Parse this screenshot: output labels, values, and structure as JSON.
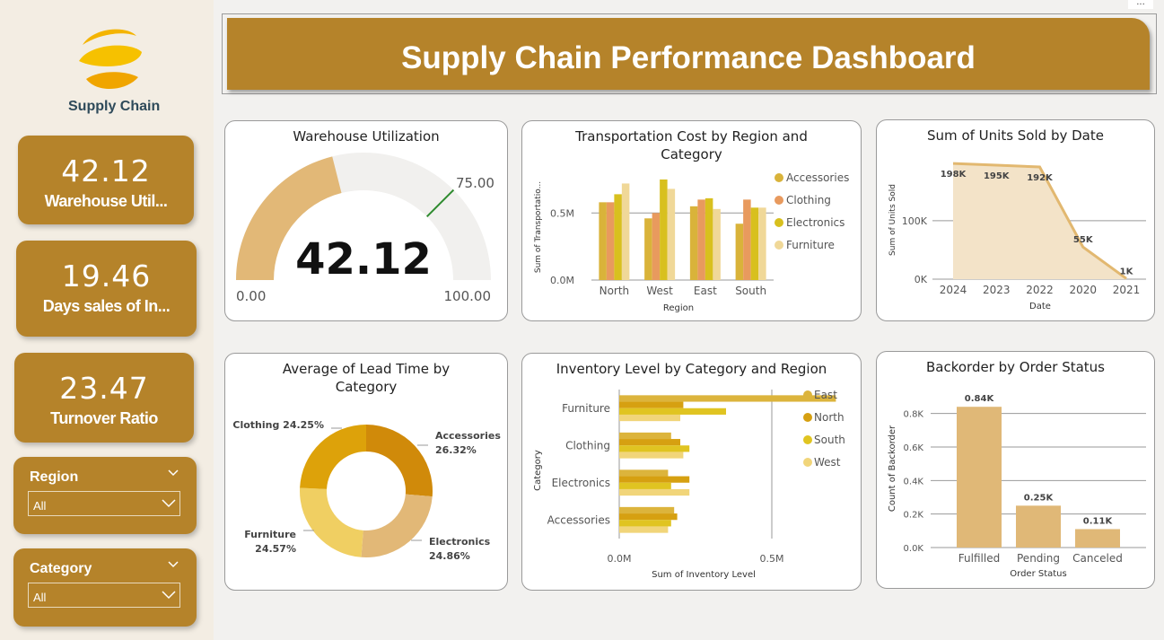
{
  "brand": {
    "name": "Supply Chain"
  },
  "header": {
    "title": "Supply Chain Performance Dashboard",
    "more_menu": "..."
  },
  "kpis": [
    {
      "value": "42.12",
      "label": "Warehouse Util..."
    },
    {
      "value": "19.46",
      "label": "Days sales of In..."
    },
    {
      "value": "23.47",
      "label": "Turnover Ratio"
    }
  ],
  "slicers": {
    "region": {
      "label": "Region",
      "value": "All"
    },
    "category": {
      "label": "Category",
      "value": "All"
    }
  },
  "colors": {
    "gold": "#b5832a",
    "accessories": "#d9b33a",
    "clothing": "#e89a5e",
    "electronics": "#d8c01e",
    "furniture": "#f0d898",
    "area": "#e2b870"
  },
  "cards": {
    "warehouse": {
      "title": "Warehouse Utilization"
    },
    "transport": {
      "title_line1": "Transportation Cost by Region and",
      "title_line2": "Category"
    },
    "units": {
      "title": "Sum of Units Sold by Date"
    },
    "leadtime": {
      "title_line1": "Average of Lead Time by",
      "title_line2": "Category"
    },
    "inventory": {
      "title": "Inventory Level by Category and Region"
    },
    "backorder": {
      "title": "Backorder by Order Status"
    }
  },
  "chart_data": [
    {
      "type": "gauge",
      "title": "Warehouse Utilization",
      "value": 42.12,
      "value_label": "42.12",
      "min": 0,
      "max": 100,
      "target": 75,
      "min_label": "0.00",
      "max_label": "100.00",
      "target_label": "75.00"
    },
    {
      "type": "bar",
      "title": "Transportation Cost by Region and Category",
      "xlabel": "Region",
      "ylabel": "Sum of Transportatio...",
      "categories": [
        "North",
        "West",
        "East",
        "South"
      ],
      "yticks": [
        "0.0M",
        "0.5M"
      ],
      "ylim": [
        0,
        0.85
      ],
      "series": [
        {
          "name": "Accessories",
          "color": "#d9b33a",
          "values": [
            0.58,
            0.46,
            0.55,
            0.42
          ]
        },
        {
          "name": "Clothing",
          "color": "#e89a5e",
          "values": [
            0.58,
            0.5,
            0.6,
            0.6
          ]
        },
        {
          "name": "Electronics",
          "color": "#d8c01e",
          "values": [
            0.64,
            0.75,
            0.61,
            0.54
          ]
        },
        {
          "name": "Furniture",
          "color": "#f0d898",
          "values": [
            0.72,
            0.68,
            0.53,
            0.54
          ]
        }
      ],
      "legend": "right"
    },
    {
      "type": "area",
      "title": "Sum of Units Sold by Date",
      "xlabel": "Date",
      "ylabel": "Sum of Units Sold",
      "x": [
        "2024",
        "2023",
        "2022",
        "2020",
        "2021"
      ],
      "values": [
        198,
        195,
        192,
        55,
        1
      ],
      "data_labels": [
        "198K",
        "195K",
        "192K",
        "55K",
        "1K"
      ],
      "yticks": [
        "0K",
        "100K"
      ],
      "ylim": [
        0,
        215
      ]
    },
    {
      "type": "pie",
      "title": "Average of Lead Time by Category",
      "slices": [
        {
          "name": "Accessories",
          "value": 26.32,
          "label": "Accessories",
          "pct": "26.32%",
          "color": "#d08a0a"
        },
        {
          "name": "Electronics",
          "value": 24.86,
          "label": "Electronics",
          "pct": "24.86%",
          "color": "#e2b877"
        },
        {
          "name": "Furniture",
          "value": 24.57,
          "label": "Furniture",
          "pct": "24.57%",
          "color": "#f0cf62"
        },
        {
          "name": "Clothing",
          "value": 24.25,
          "label": "Clothing 24.25%",
          "pct": "",
          "color": "#dda20a"
        }
      ]
    },
    {
      "type": "bar",
      "orientation": "horizontal",
      "title": "Inventory Level by Category and Region",
      "xlabel": "Sum of Inventory Level",
      "ylabel": "Category",
      "categories": [
        "Furniture",
        "Clothing",
        "Electronics",
        "Accessories"
      ],
      "xticks": [
        "0.0M",
        "0.5M"
      ],
      "xlim": [
        0,
        0.75
      ],
      "series": [
        {
          "name": "East",
          "color": "#dcb43c",
          "values": [
            0.71,
            0.17,
            0.16,
            0.18
          ]
        },
        {
          "name": "North",
          "color": "#d6a011",
          "values": [
            0.21,
            0.2,
            0.23,
            0.19
          ]
        },
        {
          "name": "South",
          "color": "#e0c421",
          "values": [
            0.35,
            0.23,
            0.17,
            0.17
          ]
        },
        {
          "name": "West",
          "color": "#f1d57a",
          "values": [
            0.2,
            0.21,
            0.23,
            0.16
          ]
        }
      ],
      "legend": "right"
    },
    {
      "type": "bar",
      "title": "Backorder by Order Status",
      "xlabel": "Order Status",
      "ylabel": "Count of Backorder",
      "categories": [
        "Fulfilled",
        "Pending",
        "Canceled"
      ],
      "values": [
        0.84,
        0.25,
        0.11
      ],
      "data_labels": [
        "0.84K",
        "0.25K",
        "0.11K"
      ],
      "yticks": [
        "0.0K",
        "0.2K",
        "0.4K",
        "0.6K",
        "0.8K"
      ],
      "ylim": [
        0,
        0.9
      ],
      "color": "#e0b877"
    }
  ]
}
